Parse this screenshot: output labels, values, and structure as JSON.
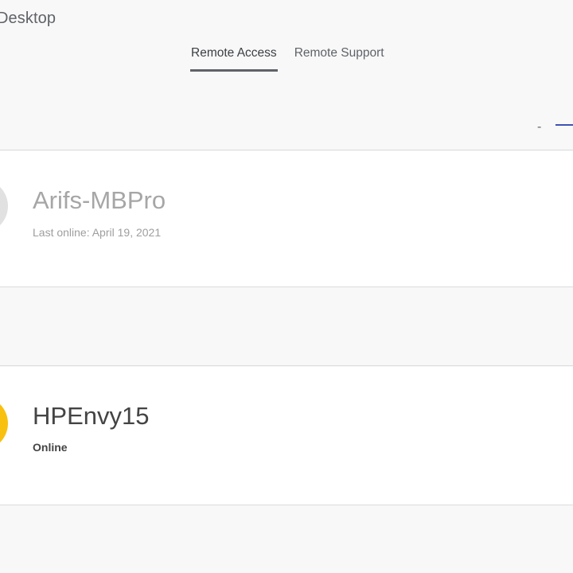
{
  "app": {
    "title": "Desktop"
  },
  "tabs": [
    {
      "label": "Remote Access",
      "active": true
    },
    {
      "label": "Remote Support",
      "active": false
    }
  ],
  "toolbar": {
    "dash_text": "-"
  },
  "devices": [
    {
      "name": "Arifs-MBPro",
      "status": "Last online: April 19, 2021",
      "online": false,
      "avatar_color": "#e1e1e1"
    },
    {
      "name": "HPEnvy15",
      "status": "Online",
      "online": true,
      "avatar_color": "#f9c10f"
    }
  ],
  "colors": {
    "accent": "#3f51b5",
    "background": "#f8f8f8",
    "card": "#ffffff",
    "divider": "#dadce0"
  }
}
